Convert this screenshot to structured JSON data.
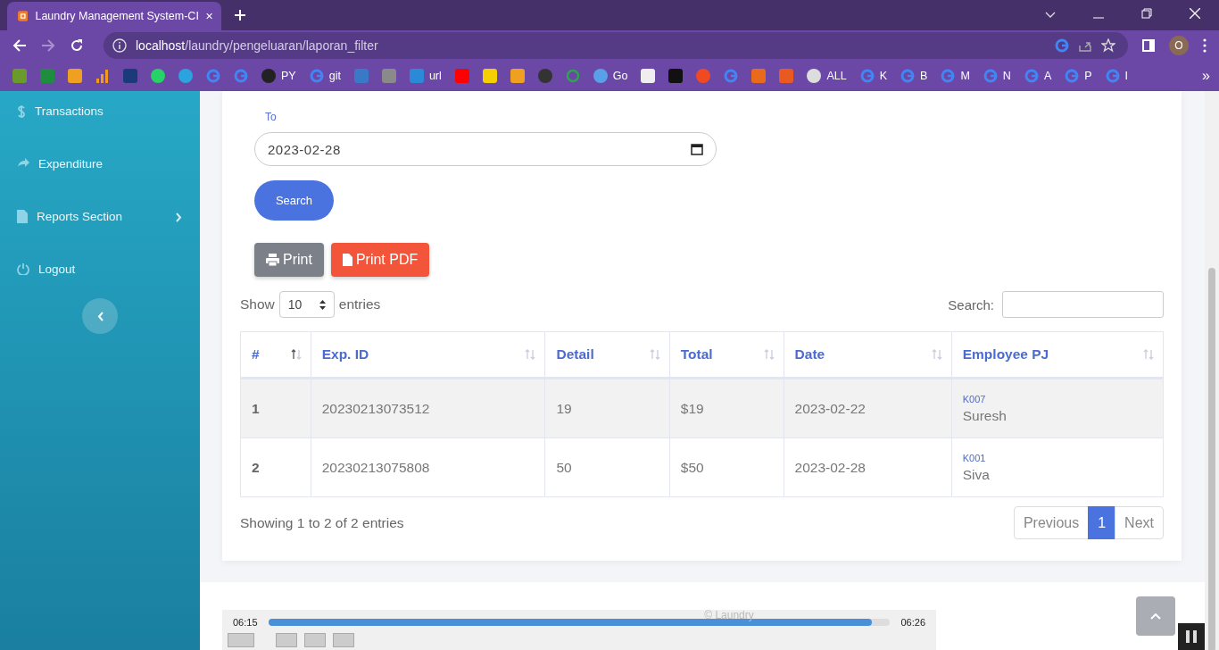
{
  "browser": {
    "tab": {
      "title": "Laundry Management System-CI",
      "selected": true
    },
    "url": {
      "host": "localhost",
      "path": "/laundry/pengeluaran/laporan_filter"
    },
    "profile": "O",
    "bookmarks": [
      {
        "kind": "app",
        "color": "#6a9a2a"
      },
      {
        "kind": "app",
        "color": "#1e8e3e"
      },
      {
        "kind": "app",
        "color": "#f0a020"
      },
      {
        "kind": "bars",
        "color": "#f29a1f"
      },
      {
        "kind": "app",
        "color": "#1b3a7a"
      },
      {
        "kind": "round",
        "color": "#25d366"
      },
      {
        "kind": "round",
        "color": "#2aa3df"
      },
      {
        "kind": "google",
        "color": "#4285f4"
      },
      {
        "kind": "google",
        "color": "#4285f4"
      },
      {
        "kind": "round",
        "label": "PY",
        "color": "#222222"
      },
      {
        "kind": "google",
        "label": "git",
        "color": "#4285f4"
      },
      {
        "kind": "app",
        "color": "#3a78c8"
      },
      {
        "kind": "app",
        "color": "#8a8a8a"
      },
      {
        "kind": "app",
        "label": "url",
        "color": "#2a8ad8"
      },
      {
        "kind": "app",
        "color": "#ff0000"
      },
      {
        "kind": "app",
        "color": "#f5d000"
      },
      {
        "kind": "app",
        "color": "#f0a020"
      },
      {
        "kind": "round",
        "color": "#333333"
      },
      {
        "kind": "ring",
        "color": "#2da44e"
      },
      {
        "kind": "round",
        "label": "Go",
        "color": "#5aa0e8"
      },
      {
        "kind": "app",
        "color": "#eeeeee"
      },
      {
        "kind": "app",
        "color": "#111111"
      },
      {
        "kind": "round",
        "color": "#f04a23"
      },
      {
        "kind": "google",
        "color": "#4285f4"
      },
      {
        "kind": "app",
        "color": "#e86a1a"
      },
      {
        "kind": "app",
        "color": "#e85a20"
      },
      {
        "kind": "round",
        "label": "ALL",
        "color": "#dddddd"
      },
      {
        "kind": "google",
        "label": "K",
        "color": "#4285f4"
      },
      {
        "kind": "google",
        "label": "B",
        "color": "#4285f4"
      },
      {
        "kind": "google",
        "label": "M",
        "color": "#4285f4"
      },
      {
        "kind": "google",
        "label": "N",
        "color": "#4285f4"
      },
      {
        "kind": "google",
        "label": "A",
        "color": "#4285f4"
      },
      {
        "kind": "google",
        "label": "P",
        "color": "#4285f4"
      },
      {
        "kind": "google",
        "label": "I",
        "color": "#4285f4"
      }
    ],
    "more": "»"
  },
  "sidebar": {
    "items": [
      {
        "label": "Transactions",
        "submenu": false
      },
      {
        "label": "Expenditure",
        "submenu": false
      },
      {
        "label": "Reports Section",
        "submenu": true
      },
      {
        "label": "Logout",
        "submenu": false
      }
    ]
  },
  "filter": {
    "to_label": "To",
    "to_value": "2023-02-28",
    "search_button": "Search"
  },
  "actions": [
    {
      "kind": "print",
      "label": "Print"
    },
    {
      "kind": "pdf",
      "label": "Print PDF"
    }
  ],
  "table_controls": {
    "show_label": "Show",
    "page_size": "10",
    "entries_label": "entries",
    "search_label": "Search:"
  },
  "table": {
    "columns": [
      {
        "label": "#",
        "sorted_ascending": true
      },
      {
        "label": "Exp. ID",
        "sorted_ascending": false
      },
      {
        "label": "Detail",
        "sorted_ascending": false
      },
      {
        "label": "Total",
        "sorted_ascending": false
      },
      {
        "label": "Date",
        "sorted_ascending": false
      },
      {
        "label": "Employee PJ",
        "sorted_ascending": false
      }
    ],
    "rows": [
      {
        "no": "1",
        "exp_id": "20230213073512",
        "detail": "19",
        "total": "$19",
        "date": "2023-02-22",
        "employee_code": "K007",
        "employee_name": "Suresh"
      },
      {
        "no": "2",
        "exp_id": "20230213075808",
        "detail": "50",
        "total": "$50",
        "date": "2023-02-28",
        "employee_code": "K001",
        "employee_name": "Siva"
      }
    ]
  },
  "info": "Showing 1 to 2 of 2 entries",
  "pagination": [
    {
      "label": "Previous",
      "selected": false
    },
    {
      "label": "1",
      "selected": true
    },
    {
      "label": "Next",
      "selected": false
    }
  ],
  "footer": "© Laundry",
  "player": {
    "elapsed": "06:15",
    "duration": "06:26",
    "level": 0.97
  }
}
